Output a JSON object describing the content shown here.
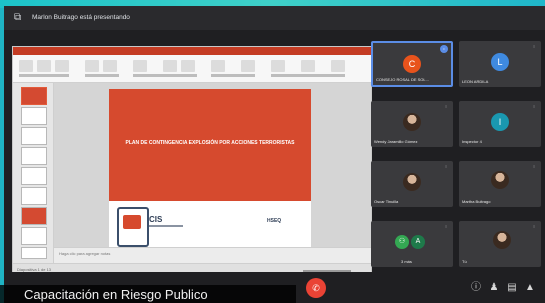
{
  "window": {
    "title": "Marlon Buitrago está presentando"
  },
  "slide": {
    "title": "PLAN DE CONTINGENCIA EXPLOSIÓN POR ACCIONES TERRORISTAS",
    "logo": "CIS",
    "right_text": "HSEQ"
  },
  "ppt": {
    "notes": "Haga clic para agregar notas",
    "status": "Diapositiva 1 de 13"
  },
  "participants": [
    {
      "name": "CONSEJO ROSAL DE SOL...",
      "initial": "C",
      "color": "#e8531c"
    },
    {
      "name": "LEON ARDILA",
      "initial": "L",
      "color": "#3f8ae0"
    },
    {
      "name": "Wendy Jaramillo Gómez",
      "initial": "",
      "color": ""
    },
    {
      "name": "Inspector 4",
      "initial": "I",
      "color": "#1a98b0"
    },
    {
      "name": "Oscar Tinuilla",
      "initial": "",
      "color": ""
    },
    {
      "name": "Martha Buitrago",
      "initial": "",
      "color": ""
    },
    {
      "name": "3 más",
      "initial": "",
      "color": "#34a853"
    },
    {
      "name": "Tú",
      "initial": "",
      "color": ""
    }
  ],
  "caption": "Capacitación en Riesgo Publico"
}
